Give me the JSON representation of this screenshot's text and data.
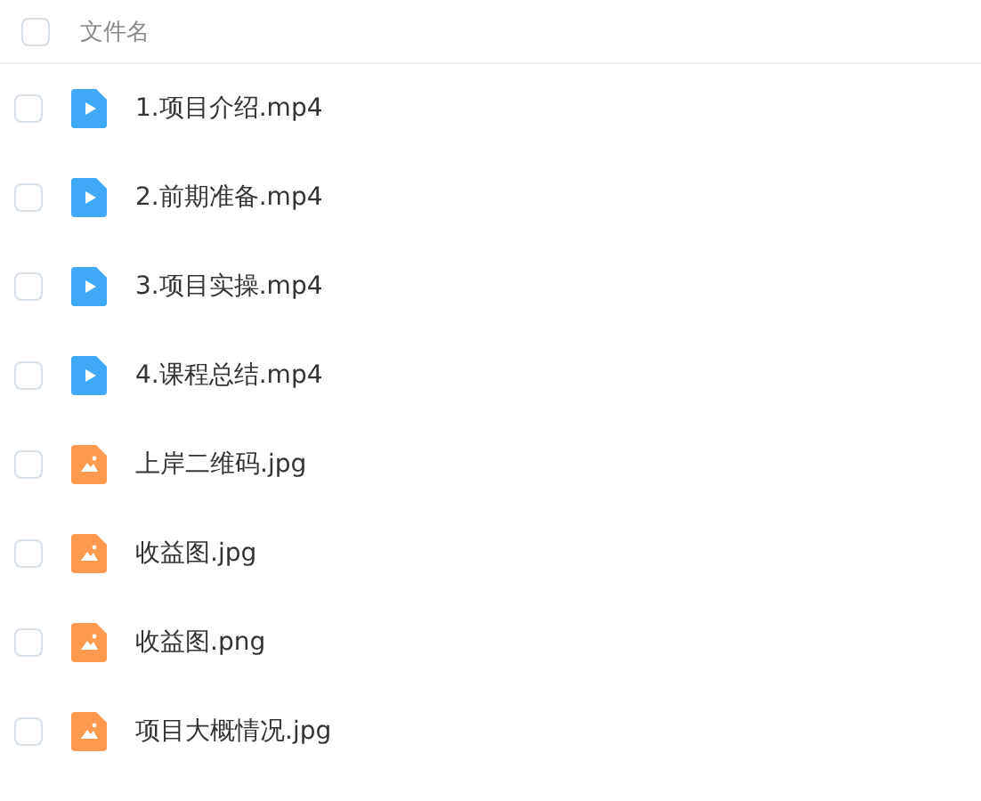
{
  "header": {
    "checked": false,
    "label": "文件名"
  },
  "files": [
    {
      "kind": "video",
      "name": "1.项目介绍.mp4",
      "checked": false
    },
    {
      "kind": "video",
      "name": "2.前期准备.mp4",
      "checked": false
    },
    {
      "kind": "video",
      "name": "3.项目实操.mp4",
      "checked": false
    },
    {
      "kind": "video",
      "name": "4.课程总结.mp4",
      "checked": false
    },
    {
      "kind": "image",
      "name": "上岸二维码.jpg",
      "checked": false
    },
    {
      "kind": "image",
      "name": "收益图.jpg",
      "checked": false
    },
    {
      "kind": "image",
      "name": "收益图.png",
      "checked": false
    },
    {
      "kind": "image",
      "name": "项目大概情况.jpg",
      "checked": false
    }
  ]
}
